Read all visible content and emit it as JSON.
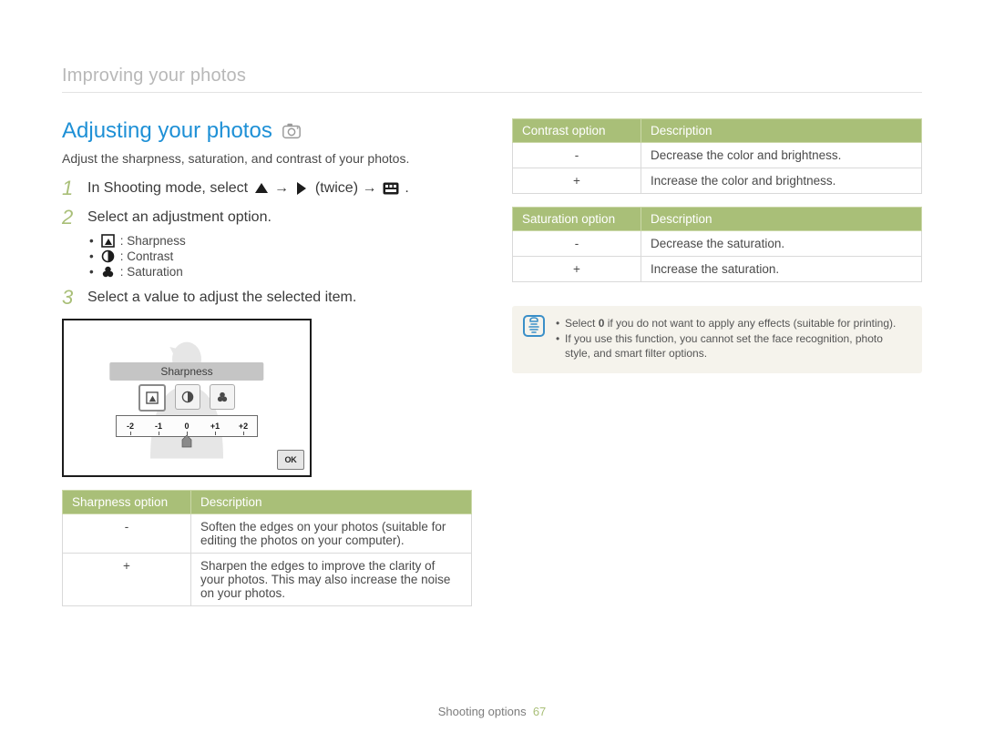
{
  "breadcrumb": "Improving your photos",
  "title": "Adjusting your photos",
  "mode_icon": "camera-p-mode",
  "lead": "Adjust the sharpness, saturation, and contrast of your photos.",
  "steps": {
    "s1_pre": "In Shooting mode, select ",
    "s1_mid1": " → ",
    "s1_mid2": " (twice) → ",
    "s1_end": ".",
    "s2": "Select an adjustment option.",
    "s3": "Select a value to adjust the selected item."
  },
  "bullets": {
    "sharpness": ": Sharpness",
    "contrast": ": Contrast",
    "saturation": ": Saturation"
  },
  "preview": {
    "label": "Sharpness",
    "ticks": [
      "-2",
      "-1",
      "0",
      "+1",
      "+2"
    ],
    "ok": "OK"
  },
  "tables": {
    "sharpness": {
      "h1": "Sharpness option",
      "h2": "Description",
      "rows": [
        {
          "k": "-",
          "v": "Soften the edges on your photos (suitable for editing the photos on your computer)."
        },
        {
          "k": "+",
          "v": "Sharpen the edges to improve the clarity of your photos. This may also increase the noise on your photos."
        }
      ]
    },
    "contrast": {
      "h1": "Contrast option",
      "h2": "Description",
      "rows": [
        {
          "k": "-",
          "v": "Decrease the color and brightness."
        },
        {
          "k": "+",
          "v": "Increase the color and brightness."
        }
      ]
    },
    "saturation": {
      "h1": "Saturation option",
      "h2": "Description",
      "rows": [
        {
          "k": "-",
          "v": "Decrease the saturation."
        },
        {
          "k": "+",
          "v": "Increase the saturation."
        }
      ]
    }
  },
  "notes": {
    "n1_pre": "Select ",
    "n1_bold": "0",
    "n1_post": " if you do not want to apply any effects (suitable for printing).",
    "n2": "If you use this function, you cannot set the face recognition, photo style, and smart filter options."
  },
  "footer": {
    "label": "Shooting options",
    "page": "67"
  }
}
